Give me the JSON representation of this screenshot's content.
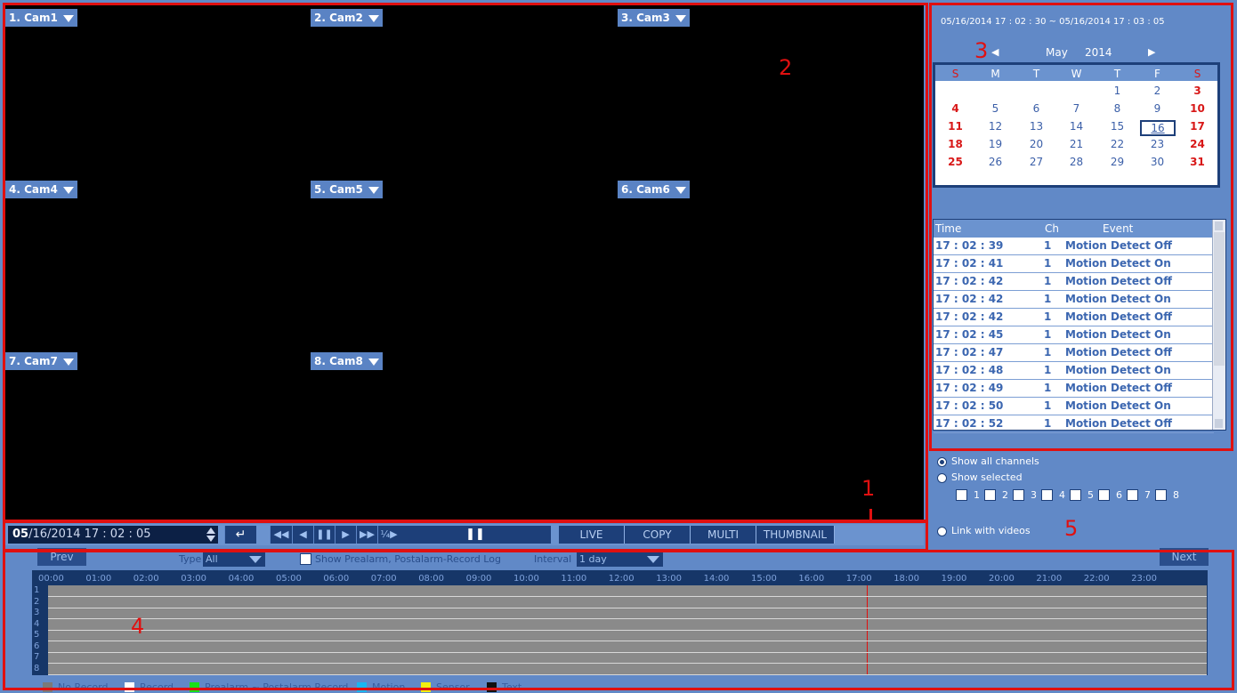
{
  "cameras": [
    "1. Cam1",
    "2. Cam2",
    "3. Cam3",
    "4. Cam4",
    "5. Cam5",
    "6. Cam6",
    "7. Cam7",
    "8. Cam8"
  ],
  "playback": {
    "date_highlight": "05",
    "date_rest": "/16/2014  17 : 02 : 05",
    "enter_icon": "↵",
    "buttons": [
      "◀◀",
      "◀",
      "❚❚",
      "▶",
      "▶▶",
      "¼▶"
    ],
    "status_icon": "❚❚",
    "modes": [
      "LIVE",
      "COPY",
      "MULTI",
      "THUMBNAIL"
    ]
  },
  "right_panel": {
    "range": "05/16/2014  17 : 02 : 30 ~ 05/16/2014  17 : 03 : 05",
    "month": "May",
    "year": "2014",
    "prev_icon": "◀",
    "next_icon": "▶",
    "weekdays": [
      "S",
      "M",
      "T",
      "W",
      "T",
      "F",
      "S"
    ],
    "weeks": [
      [
        "",
        "",
        "",
        "",
        "1",
        "2",
        "3"
      ],
      [
        "4",
        "5",
        "6",
        "7",
        "8",
        "9",
        "10"
      ],
      [
        "11",
        "12",
        "13",
        "14",
        "15",
        "16",
        "17"
      ],
      [
        "18",
        "19",
        "20",
        "21",
        "22",
        "23",
        "24"
      ],
      [
        "25",
        "26",
        "27",
        "28",
        "29",
        "30",
        "31"
      ]
    ],
    "selected_day": "16",
    "event_headers": {
      "time": "Time",
      "ch": "Ch",
      "event": "Event"
    },
    "events": [
      {
        "time": "17 : 02 : 39",
        "ch": "1",
        "event": "Motion Detect Off"
      },
      {
        "time": "17 : 02 : 41",
        "ch": "1",
        "event": "Motion Detect On"
      },
      {
        "time": "17 : 02 : 42",
        "ch": "1",
        "event": "Motion Detect Off"
      },
      {
        "time": "17 : 02 : 42",
        "ch": "1",
        "event": "Motion Detect On"
      },
      {
        "time": "17 : 02 : 42",
        "ch": "1",
        "event": "Motion Detect Off"
      },
      {
        "time": "17 : 02 : 45",
        "ch": "1",
        "event": "Motion Detect On"
      },
      {
        "time": "17 : 02 : 47",
        "ch": "1",
        "event": "Motion Detect Off"
      },
      {
        "time": "17 : 02 : 48",
        "ch": "1",
        "event": "Motion Detect On"
      },
      {
        "time": "17 : 02 : 49",
        "ch": "1",
        "event": "Motion Detect Off"
      },
      {
        "time": "17 : 02 : 50",
        "ch": "1",
        "event": "Motion Detect On"
      },
      {
        "time": "17 : 02 : 52",
        "ch": "1",
        "event": "Motion Detect Off"
      }
    ]
  },
  "channels": {
    "show_all": "Show all channels",
    "show_selected": "Show selected",
    "numbers": [
      "1",
      "2",
      "3",
      "4",
      "5",
      "6",
      "7",
      "8"
    ],
    "link_videos": "Link with videos"
  },
  "bottom": {
    "prev": "Prev",
    "next": "Next",
    "type_label": "Type",
    "type_value": "All",
    "log_label": "Show Prealarm, Postalarm-Record Log",
    "interval_label": "Interval",
    "interval_value": "1 day",
    "hours": [
      "00:00",
      "01:00",
      "02:00",
      "03:00",
      "04:00",
      "05:00",
      "06:00",
      "07:00",
      "08:00",
      "09:00",
      "10:00",
      "11:00",
      "12:00",
      "13:00",
      "14:00",
      "15:00",
      "16:00",
      "17:00",
      "18:00",
      "19:00",
      "20:00",
      "21:00",
      "22:00",
      "23:00"
    ],
    "rows": [
      "1",
      "2",
      "3",
      "4",
      "5",
      "6",
      "7",
      "8"
    ],
    "legend": [
      {
        "label": "No Record",
        "color": "#7a7a7a"
      },
      {
        "label": "Record",
        "color": "#ffffff"
      },
      {
        "label": "Prealarm ~ Postalarm Record",
        "color": "#18e018"
      },
      {
        "label": "Motion",
        "color": "#19b6f0"
      },
      {
        "label": "Sensor",
        "color": "#f0f010"
      },
      {
        "label": "Text",
        "color": "#111111"
      }
    ]
  },
  "annotations": [
    "1",
    "2",
    "3",
    "4",
    "5"
  ]
}
